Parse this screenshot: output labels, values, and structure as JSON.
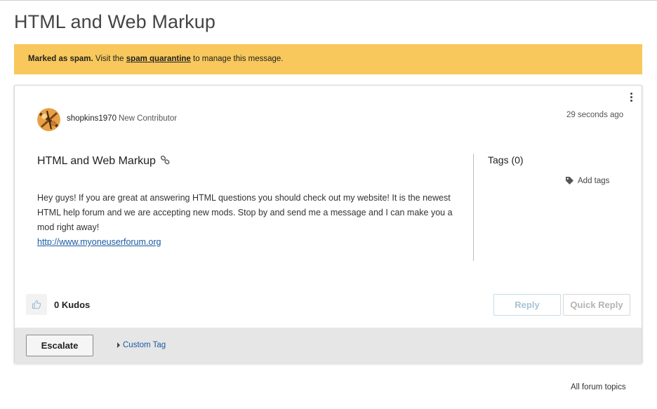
{
  "page": {
    "title": "HTML and Web Markup"
  },
  "spam_banner": {
    "strong": "Marked as spam.",
    "pre_link": " Visit the ",
    "link": "spam quarantine",
    "post_link": " to manage this message."
  },
  "post": {
    "menu_icon": "kebab-vertical-icon",
    "author": {
      "name": "shopkins1970",
      "rank": "New Contributor",
      "avatar_icon": "avatar-image"
    },
    "timestamp": "29 seconds ago",
    "title": "HTML and Web Markup",
    "title_icon": "link-icon",
    "body": "Hey guys! If you are great at answering HTML questions you should check out my website! It is the newest HTML help forum and we are accepting new mods. Stop by and send me a message and I can make you a mod right away!",
    "link": "http://www.myoneuserforum.org"
  },
  "tags": {
    "title": "Tags (0)",
    "add_label": "Add tags",
    "add_icon": "tag-icon"
  },
  "kudos": {
    "icon": "thumbs-up-icon",
    "label": "0 Kudos"
  },
  "actions": {
    "reply": "Reply",
    "quick_reply": "Quick Reply"
  },
  "footer": {
    "escalate": "Escalate",
    "custom_tag": "Custom Tag",
    "custom_tag_icon": "caret-right-icon"
  },
  "nav": {
    "all_topics": "All forum topics"
  },
  "colors": {
    "banner": "#f8c85c",
    "link": "#1a5aa0",
    "footer_bg": "#e6e6e6"
  }
}
